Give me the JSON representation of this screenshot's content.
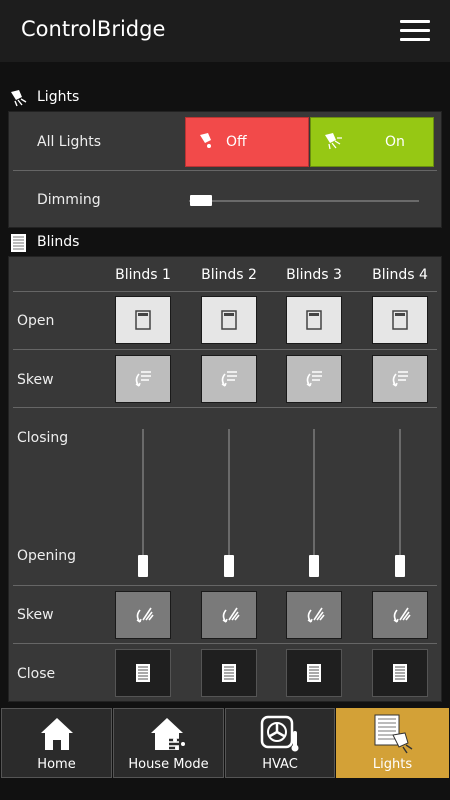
{
  "header": {
    "title": "ControlBridge",
    "menu_icon": "hamburger-menu-icon"
  },
  "lights": {
    "section_title": "Lights",
    "all_lights_label": "All Lights",
    "off_label": "Off",
    "on_label": "On",
    "dimming_label": "Dimming",
    "dimming_value": 0,
    "colors": {
      "off": "#f24a4a",
      "on": "#96c814"
    }
  },
  "blinds": {
    "section_title": "Blinds",
    "columns": [
      "Blinds 1",
      "Blinds 2",
      "Blinds 3",
      "Blinds 4"
    ],
    "rows": {
      "open": "Open",
      "skew_up": "Skew",
      "closing": "Closing",
      "opening": "Opening",
      "skew_down": "Skew",
      "close": "Close"
    },
    "positions": [
      0,
      0,
      0,
      0
    ]
  },
  "tabs": [
    {
      "label": "Home",
      "icon": "home-icon"
    },
    {
      "label": "House Mode",
      "icon": "house-mode-icon"
    },
    {
      "label": "HVAC",
      "icon": "hvac-icon"
    },
    {
      "label": "Lights",
      "icon": "lights-icon",
      "active": true
    }
  ],
  "accent_color": "#d3a137"
}
